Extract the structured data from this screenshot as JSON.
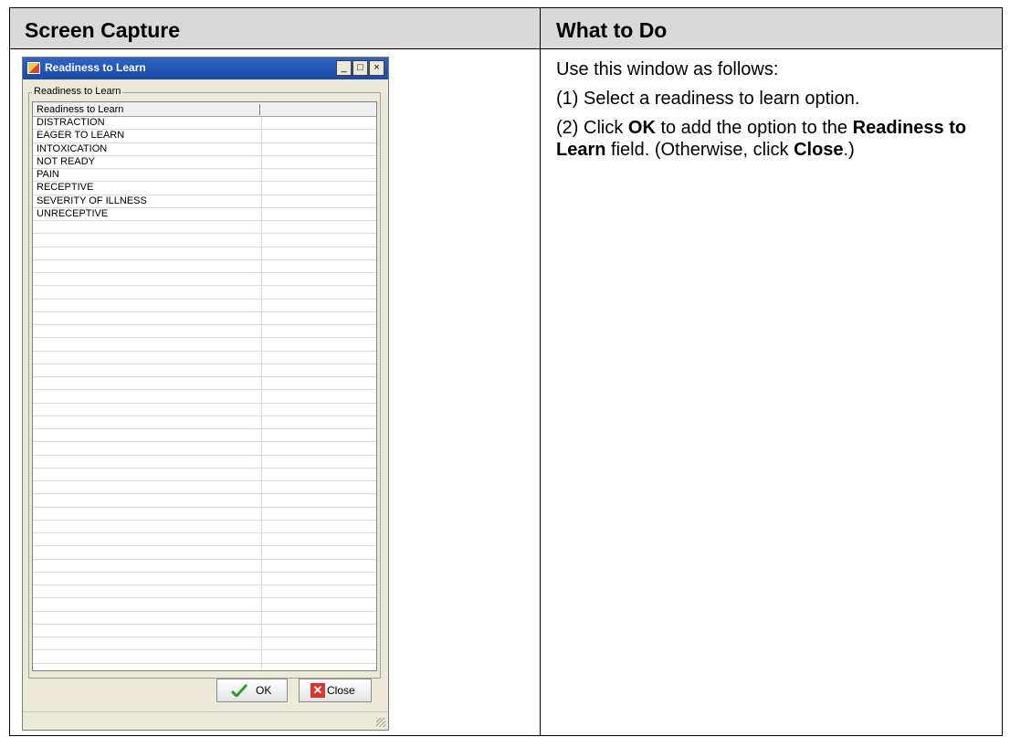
{
  "table": {
    "col_left_header": "Screen Capture",
    "col_right_header": "What to Do"
  },
  "instructions": {
    "intro": "Use this window as follows:",
    "step1": "(1) Select a readiness to learn option.",
    "step2_pre": "(2) Click ",
    "step2_ok": "OK",
    "step2_mid": " to add the option to the ",
    "step2_field": "Readiness to Learn",
    "step2_post": " field. (Otherwise, click ",
    "step2_close": "Close",
    "step2_end": ".)"
  },
  "window": {
    "title": "Readiness to Learn",
    "minimize": "_",
    "maximize": "□",
    "close": "×",
    "group_label": "Readiness to Learn",
    "column_header": "Readiness to Learn",
    "options": [
      "DISTRACTION",
      "EAGER TO LEARN",
      "INTOXICATION",
      "NOT READY",
      "PAIN",
      "RECEPTIVE",
      "SEVERITY OF ILLNESS",
      "UNRECEPTIVE"
    ],
    "ok_label": "OK",
    "close_label": "Close"
  },
  "colors": {
    "header_bg": "#d9d9d9",
    "titlebar": "#1b4aa8",
    "window_bg": "#ece9d8"
  }
}
